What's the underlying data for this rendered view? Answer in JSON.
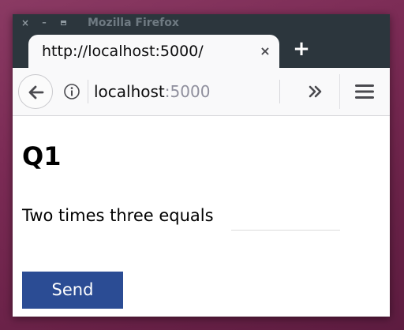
{
  "window": {
    "title": "Mozilla Firefox",
    "controls": {
      "close": "×",
      "minimize": "–"
    }
  },
  "tab": {
    "title": "http://localhost:5000/",
    "close_glyph": "×"
  },
  "new_tab_glyph": "+",
  "urlbar": {
    "host": "localhost",
    "port": ":5000"
  },
  "page": {
    "heading": "Q1",
    "question": "Two times three equals",
    "answer_value": "",
    "submit_label": "Send"
  },
  "colors": {
    "desktop_bg": "#7b2b55",
    "titlebar_bg": "#2c363d",
    "button_bg": "#2b4c94"
  },
  "icons": {
    "back": "back-arrow-icon",
    "info": "info-icon",
    "overflow": "chevrons-right-icon",
    "menu": "hamburger-menu-icon"
  }
}
